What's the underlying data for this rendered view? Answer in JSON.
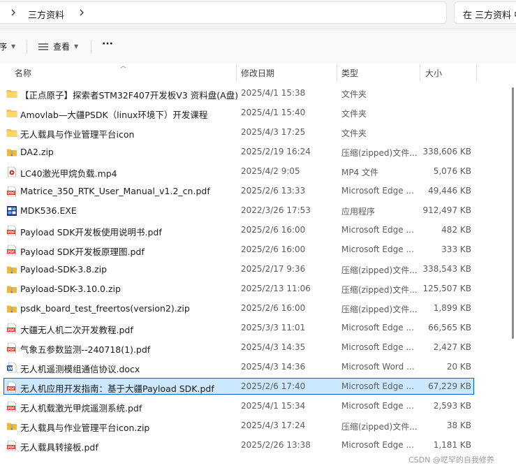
{
  "address_bar": {
    "folder": "三方资料"
  },
  "search": {
    "placeholder": "在 三方资料 中搜索"
  },
  "toolbar": {
    "sort_label": "序",
    "view_label": "查看",
    "more_label": "···"
  },
  "columns": {
    "name": "名称",
    "date": "修改日期",
    "type": "类型",
    "size": "大小"
  },
  "files": [
    {
      "icon": "folder-icon",
      "name": "【正点原子】探索者STM32F407开发板V3 资料盘(A盘)",
      "date": "2025/4/1 15:38",
      "type": "文件夹",
      "size": ""
    },
    {
      "icon": "folder-icon",
      "name": "Amovlab—大疆PSDK（linux环境下）开发课程",
      "date": "2025/4/1 15:40",
      "type": "文件夹",
      "size": ""
    },
    {
      "icon": "folder-icon",
      "name": "无人载具与作业管理平台icon",
      "date": "2025/4/3 17:25",
      "type": "文件夹",
      "size": ""
    },
    {
      "icon": "zip-icon",
      "name": "DA2.zip",
      "date": "2025/2/19 16:24",
      "type": "压缩(zipped)文件...",
      "size": "338,606 KB"
    },
    {
      "icon": "video-icon",
      "name": "LC40激光甲烷负载.mp4",
      "date": "2025/4/2 9:05",
      "type": "MP4 文件",
      "size": "5,076 KB"
    },
    {
      "icon": "pdf-icon",
      "name": "Matrice_350_RTK_User_Manual_v1.2_cn.pdf",
      "date": "2025/2/6 13:33",
      "type": "Microsoft Edge ...",
      "size": "49,446 KB"
    },
    {
      "icon": "exe-icon",
      "name": "MDK536.EXE",
      "date": "2022/3/26 17:53",
      "type": "应用程序",
      "size": "912,497 KB"
    },
    {
      "icon": "pdf-icon",
      "name": "Payload SDK开发板使用说明书.pdf",
      "date": "2025/2/6 16:00",
      "type": "Microsoft Edge ...",
      "size": "482 KB"
    },
    {
      "icon": "pdf-icon",
      "name": "Payload SDK开发板原理图.pdf",
      "date": "2025/2/6 16:00",
      "type": "Microsoft Edge ...",
      "size": "333 KB"
    },
    {
      "icon": "zip-icon",
      "name": "Payload-SDK-3.8.zip",
      "date": "2025/2/17 9:36",
      "type": "压缩(zipped)文件...",
      "size": "338,543 KB"
    },
    {
      "icon": "zip-icon",
      "name": "Payload-SDK-3.10.0.zip",
      "date": "2025/2/13 11:06",
      "type": "压缩(zipped)文件...",
      "size": "125,507 KB"
    },
    {
      "icon": "zip-icon",
      "name": "psdk_board_test_freertos(version2).zip",
      "date": "2025/2/6 16:00",
      "type": "压缩(zipped)文件...",
      "size": "1,899 KB"
    },
    {
      "icon": "pdf-icon",
      "name": "大疆无人机二次开发教程.pdf",
      "date": "2025/3/3 11:01",
      "type": "Microsoft Edge ...",
      "size": "66,565 KB"
    },
    {
      "icon": "pdf-icon",
      "name": "气象五参数监测--240718(1).pdf",
      "date": "2025/4/3 14:35",
      "type": "Microsoft Edge ...",
      "size": "2,427 KB"
    },
    {
      "icon": "word-icon",
      "name": "无人机遥测模组通信协议.docx",
      "date": "2025/4/3 14:36",
      "type": "Microsoft Word ...",
      "size": "20 KB"
    },
    {
      "icon": "pdf-icon",
      "name": "无人机应用开发指南：基于大疆Payload SDK.pdf",
      "date": "2025/2/6 17:40",
      "type": "Microsoft Edge ...",
      "size": "67,229 KB",
      "selected": true
    },
    {
      "icon": "pdf-icon",
      "name": "无人机载激光甲烷遥测系统.pdf",
      "date": "2025/4/1 15:34",
      "type": "Microsoft Edge ...",
      "size": "2,593 KB"
    },
    {
      "icon": "zip-icon",
      "name": "无人载具与作业管理平台icon.zip",
      "date": "2025/4/3 17:24",
      "type": "压缩(zipped)文件...",
      "size": "38 KB"
    },
    {
      "icon": "pdf-icon",
      "name": "无人载具转接板.pdf",
      "date": "2025/2/26 13:38",
      "type": "Microsoft Edge ...",
      "size": "1,181 KB"
    }
  ],
  "watermark": "CSDN @呓罕的自我修养"
}
